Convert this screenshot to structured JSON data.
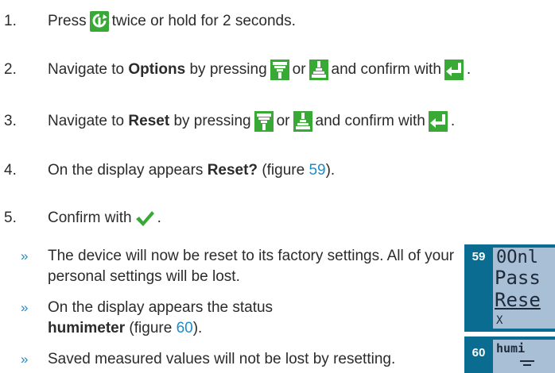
{
  "steps": [
    {
      "num": "1.",
      "text_a": "Press",
      "icon": "power-rotate-icon",
      "text_b": "twice or hold for 2 seconds."
    },
    {
      "num": "2.",
      "text_a": "Navigate to",
      "bold": "Options",
      "text_b": "by pressing",
      "or": "or",
      "text_c": "and confirm with",
      "end": "."
    },
    {
      "num": "3.",
      "text_a": "Navigate to",
      "bold": "Reset",
      "text_b": "by pressing",
      "or": "or",
      "text_c": "and confirm with",
      "end": "."
    },
    {
      "num": "4.",
      "text_a": "On the display appears",
      "bold": "Reset?",
      "text_b": "(figure",
      "fig": "59",
      "end": ")."
    },
    {
      "num": "5.",
      "text_a": "Confirm with",
      "end": "."
    }
  ],
  "bullets": [
    {
      "symbol": "»",
      "text": "The device will now be reset to its factory settings. All of your personal settings will be lost."
    },
    {
      "symbol": "»",
      "text_a": "On the display appears the status",
      "bold": "humimeter",
      "text_b": "(figure",
      "fig": "60",
      "end": ")."
    },
    {
      "symbol": "»",
      "text": "Saved measured values will not be lost by resetting."
    }
  ],
  "figures": [
    {
      "num": "59",
      "lines": [
        "0Onl",
        "Pass",
        "Rese",
        "X"
      ]
    },
    {
      "num": "60",
      "lines": [
        "humi"
      ]
    }
  ],
  "colors": {
    "accent": "#1f8bc9",
    "figure_bg": "#0b6c92",
    "lcd_bg": "#a8bfd6",
    "icon_green": "#39a935"
  }
}
